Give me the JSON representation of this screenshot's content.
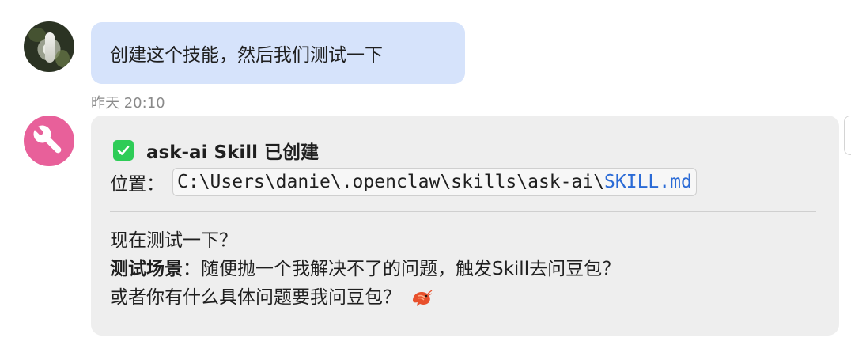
{
  "user_message": {
    "text": "创建这个技能，然后我们测试一下"
  },
  "timestamp": "昨天 20:10",
  "bot_message": {
    "title": "ask-ai Skill 已创建",
    "location_label": "位置：",
    "path_prefix": "C:\\Users\\danie\\.openclaw\\skills\\ask-ai\\",
    "path_file": "SKILL.md",
    "line1": "现在测试一下？",
    "scenario_label": "测试场景",
    "scenario_text": "：随便抛一个我解决不了的问题，触发Skill去问豆包？",
    "line3": "或者你有什么具体问题要我问豆包？",
    "icons": {
      "check": "check-box-icon",
      "shrimp": "shrimp-emoji-icon"
    }
  },
  "colors": {
    "user_bubble": "#d6e3fb",
    "bot_bubble": "#eeeeee",
    "bot_avatar": "#e8609a",
    "check": "#2ecc57",
    "link": "#2b6bd6"
  }
}
